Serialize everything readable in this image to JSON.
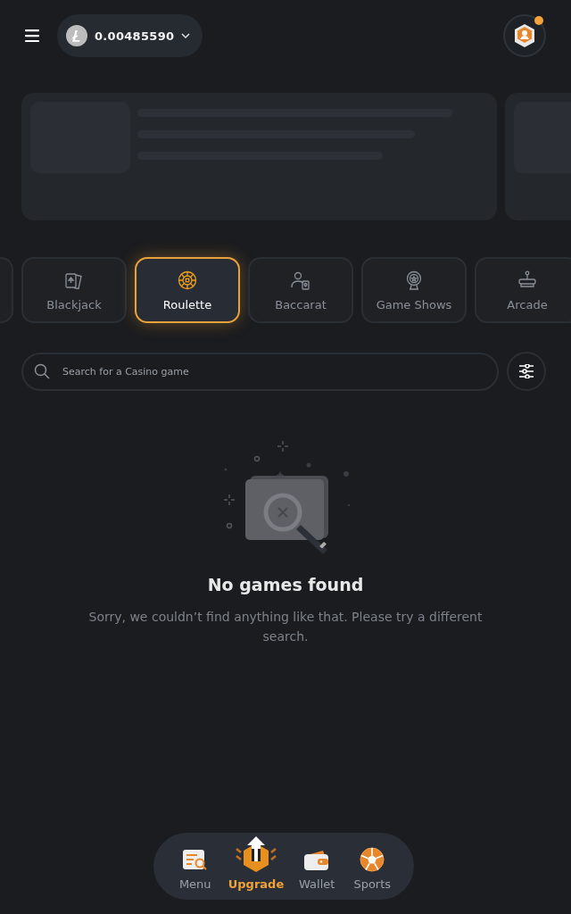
{
  "header": {
    "balance": "0.00485590",
    "notification": true
  },
  "categories": [
    {
      "label": "Blackjack",
      "selected": false
    },
    {
      "label": "Roulette",
      "selected": true
    },
    {
      "label": "Baccarat",
      "selected": false
    },
    {
      "label": "Game Shows",
      "selected": false
    },
    {
      "label": "Arcade",
      "selected": false
    }
  ],
  "search": {
    "placeholder": "Search for a Casino game"
  },
  "empty_state": {
    "title": "No games found",
    "message": "Sorry, we couldn’t find anything like that. Please try a different search."
  },
  "bottom_nav": [
    {
      "label": "Menu",
      "selected": false
    },
    {
      "label": "Upgrade",
      "selected": true
    },
    {
      "label": "Wallet",
      "selected": false
    },
    {
      "label": "Sports",
      "selected": false
    }
  ]
}
